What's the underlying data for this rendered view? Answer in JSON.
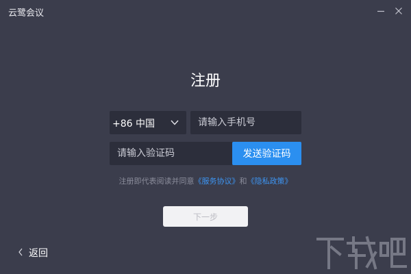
{
  "app": {
    "title": "云鹭会议"
  },
  "window": {
    "minimize_icon": "minimize-icon",
    "close_icon": "close-icon"
  },
  "page": {
    "title": "注册"
  },
  "form": {
    "country_code": "+86 中国",
    "phone_placeholder": "请输入手机号",
    "code_placeholder": "请输入验证码",
    "send_code_label": "发送验证码"
  },
  "agreement": {
    "prefix": "注册即代表阅读并同意",
    "service_link": "《服务协议》",
    "conjunction": "和",
    "privacy_link": "《隐私政策》"
  },
  "next_label": "下一步",
  "back_label": "返回",
  "watermark": {
    "text": "下载吧"
  },
  "colors": {
    "background": "#3b3d4c",
    "input_background": "#2c2e3b",
    "accent": "#2b8ff0",
    "link": "#3d95f2"
  }
}
